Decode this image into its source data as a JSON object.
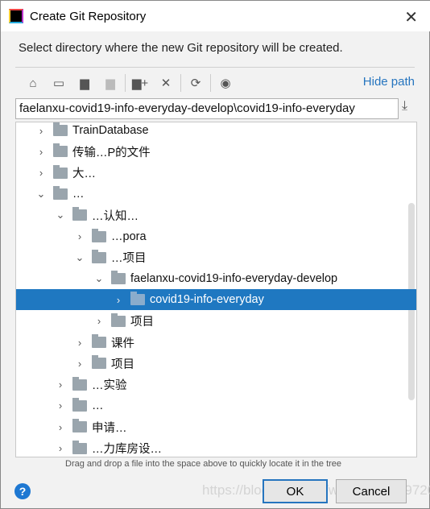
{
  "window": {
    "title": "Create Git Repository",
    "app_icon": "IJ"
  },
  "description": "Select directory where the new Git repository will be created.",
  "toolbar": {
    "icons": [
      "home-icon",
      "desktop-icon",
      "project-folder-icon",
      "module-folder-icon",
      "new-folder-icon",
      "delete-icon",
      "refresh-icon",
      "show-hidden-icon"
    ],
    "hide_path": "Hide path"
  },
  "path_value": "faelanxu-covid19-info-everyday-develop\\covid19-info-everyday",
  "tree": [
    {
      "label": "TrainDatabase",
      "level": 0,
      "expanded": false
    },
    {
      "label": "传输…P的文件",
      "level": 0,
      "expanded": false
    },
    {
      "label": "大…",
      "level": 0,
      "expanded": false
    },
    {
      "label": "…",
      "level": 0,
      "expanded": true
    },
    {
      "label": "…认知…",
      "level": 1,
      "expanded": true
    },
    {
      "label": "…pora",
      "level": 2,
      "expanded": false
    },
    {
      "label": "…项目",
      "level": 2,
      "expanded": true
    },
    {
      "label": "faelanxu-covid19-info-everyday-develop",
      "level": 3,
      "expanded": true
    },
    {
      "label": "covid19-info-everyday",
      "level": 4,
      "expanded": false,
      "selected": true
    },
    {
      "label": "项目",
      "level": 3,
      "expanded": false
    },
    {
      "label": "课件",
      "level": 2,
      "expanded": false
    },
    {
      "label": "项目",
      "level": 2,
      "expanded": false
    },
    {
      "label": "…实验",
      "level": 1,
      "expanded": false
    },
    {
      "label": "…",
      "level": 1,
      "expanded": false
    },
    {
      "label": "申请…",
      "level": 1,
      "expanded": false
    },
    {
      "label": "…力库房设…",
      "level": 1,
      "expanded": false
    }
  ],
  "hint": "Drag and drop a file into the space above to quickly locate it in the tree",
  "buttons": {
    "ok": "OK",
    "cancel": "Cancel",
    "help": "?"
  },
  "watermark": "https://blog.csdn.net/weixin_44619720",
  "colors": {
    "selection": "#1f78c1",
    "link": "#2675bf"
  }
}
